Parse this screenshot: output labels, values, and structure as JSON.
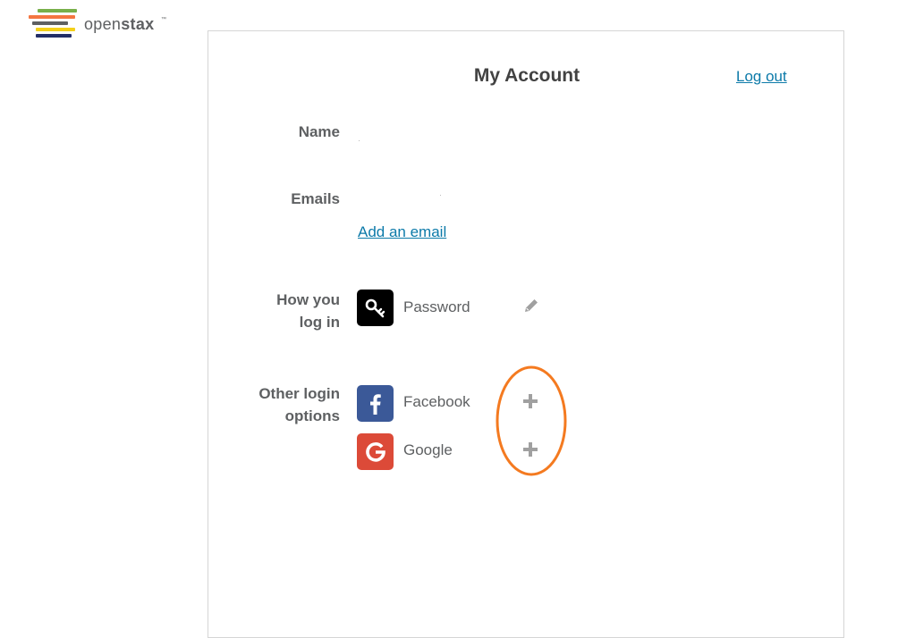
{
  "brand": {
    "name_light": "open",
    "name_bold": "stax",
    "trademark": "™",
    "bar_colors": [
      "#78b04a",
      "#f47641",
      "#5e6062",
      "#f4d019",
      "#232e66"
    ]
  },
  "account": {
    "title": "My Account",
    "logout_label": "Log out",
    "name_label": "Name",
    "emails_label": "Emails",
    "add_email_label": "Add an email",
    "how_login_label_line1": "How you",
    "how_login_label_line2": "log in",
    "other_login_label_line1": "Other login",
    "other_login_label_line2": "options"
  },
  "login_methods": {
    "password": {
      "label": "Password",
      "icon": "key-icon",
      "action_icon": "pencil-icon",
      "color": "#000000"
    },
    "facebook": {
      "label": "Facebook",
      "icon": "facebook-icon",
      "action_icon": "plus-icon",
      "color": "#3b5998"
    },
    "google": {
      "label": "Google",
      "icon": "google-icon",
      "action_icon": "plus-icon",
      "color": "#dc4a38"
    }
  },
  "colors": {
    "link": "#0c7aa9",
    "annotation": "#f47a20",
    "action_icon": "#a0a0a0"
  }
}
